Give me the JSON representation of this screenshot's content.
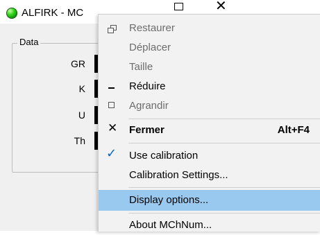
{
  "window": {
    "title": "ALFIRK - MC",
    "icon": "green-status-orb",
    "close_glyph": "✕"
  },
  "data_group": {
    "legend": "Data",
    "rows": [
      {
        "label": "GR"
      },
      {
        "label": "K"
      },
      {
        "label": "U"
      },
      {
        "label": "Th"
      }
    ]
  },
  "system_menu": {
    "items": [
      {
        "label": "Restaurer",
        "icon": "restore-icon",
        "enabled": false
      },
      {
        "label": "Déplacer",
        "enabled": false
      },
      {
        "label": "Taille",
        "enabled": false
      },
      {
        "label": "Réduire",
        "icon": "minimize-icon",
        "enabled": true
      },
      {
        "label": "Agrandir",
        "icon": "maximize-icon",
        "enabled": false
      },
      {
        "label": "Fermer",
        "icon": "close-icon",
        "shortcut": "Alt+F4",
        "enabled": true,
        "bold": true
      },
      {
        "label": "Use calibration",
        "icon": "checkmark-icon",
        "checked": true,
        "enabled": true
      },
      {
        "label": "Calibration Settings...",
        "enabled": true
      },
      {
        "label": "Display options...",
        "enabled": true,
        "highlighted": true
      },
      {
        "label": "About MChNum...",
        "enabled": true
      }
    ]
  },
  "colors": {
    "highlight": "#99c9ef",
    "menu_background": "#f2f2f2",
    "disabled_text": "#6d6d6d",
    "check": "#0a64b9"
  }
}
